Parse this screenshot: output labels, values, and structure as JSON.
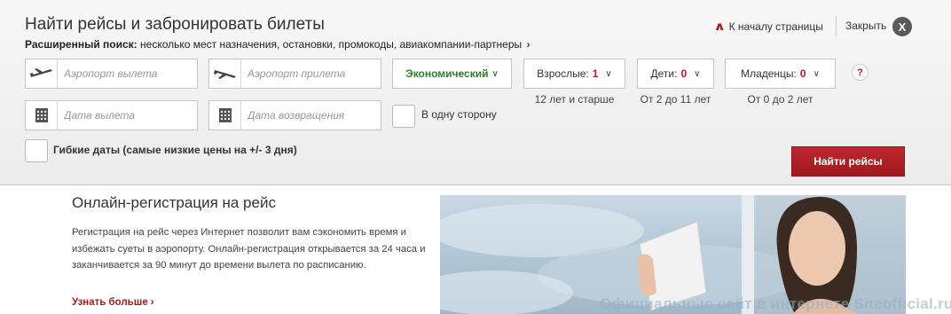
{
  "panel": {
    "title": "Найти рейсы и забронировать билеты",
    "advanced_label": "Расширенный поиск:",
    "advanced_text": "несколько мест назначения, остановки, промокоды, авиакомпании-партнеры",
    "to_top": "К началу страницы",
    "close": "Закрыть",
    "close_x": "X"
  },
  "fields": {
    "departure_placeholder": "Аэропорт вылета",
    "arrival_placeholder": "Аэропорт прилета",
    "depart_date_placeholder": "Дата вылета",
    "return_date_placeholder": "Дата возвращения"
  },
  "cabin": {
    "value": "Экономический"
  },
  "passengers": {
    "adults": {
      "label": "Взрослые:",
      "value": "1",
      "hint": "12 лет и старше"
    },
    "children": {
      "label": "Дети:",
      "value": "0",
      "hint": "От 2 до 11 лет"
    },
    "infants": {
      "label": "Младенцы:",
      "value": "0",
      "hint": "От 0 до 2 лет"
    }
  },
  "help": "?",
  "one_way": "В одну сторону",
  "flexible": "Гибкие даты (самые низкие цены на +/- 3 дня)",
  "find_button": "Найти рейсы",
  "online_checkin": {
    "title": "Онлайн-регистрация на рейс",
    "text": "Регистрация на рейс через Интернет позволит вам сэкономить время и избежать суеты в аэропорту. Онлайн-регистрация открывается за 24 часа и заканчивается за 90 минут до времени вылета по расписанию.",
    "more": "Узнать больше"
  },
  "watermark": "Официальные сайт в интернете Siteofficial.ru",
  "colors": {
    "accent": "#b01c1c",
    "button": "#b0222a",
    "economy": "#2d7d2d"
  }
}
